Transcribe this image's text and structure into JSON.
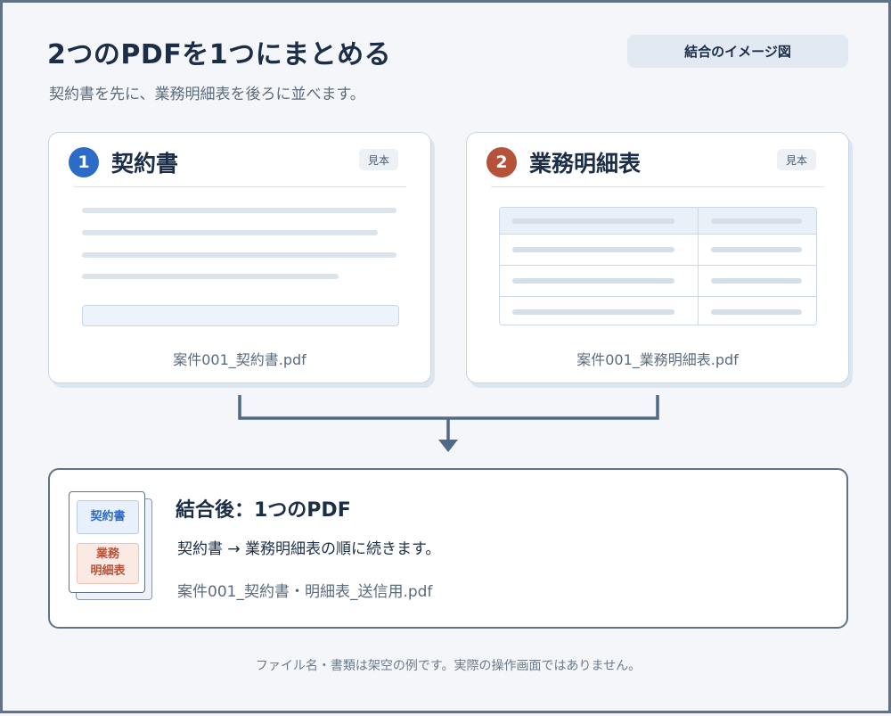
{
  "header": {
    "title": "2つのPDFを1つにまとめる",
    "subtitle": "契約書を先に、業務明細表を後ろに並べます。",
    "tag": "結合のイメージ図"
  },
  "cards": [
    {
      "number": "1",
      "title": "契約書",
      "sample": "見本",
      "filename": "案件001_契約書.pdf",
      "accent": "#2c6bc6"
    },
    {
      "number": "2",
      "title": "業務明細表",
      "sample": "見本",
      "filename": "案件001_業務明細表.pdf",
      "accent": "#b5523a"
    }
  ],
  "result": {
    "title": "結合後：1つのPDF",
    "description": "契約書 → 業務明細表の順に続きます。",
    "filename": "案件001_契約書・明細表_送信用.pdf",
    "stack_top": "契約書",
    "stack_bottom_line1": "業務",
    "stack_bottom_line2": "明細表"
  },
  "footnote": "ファイル名・書類は架空の例です。実際の操作画面ではありません。",
  "colors": {
    "blue_accent": "#2c6bc6",
    "red_accent": "#b5523a",
    "connector": "#4f6a86"
  }
}
